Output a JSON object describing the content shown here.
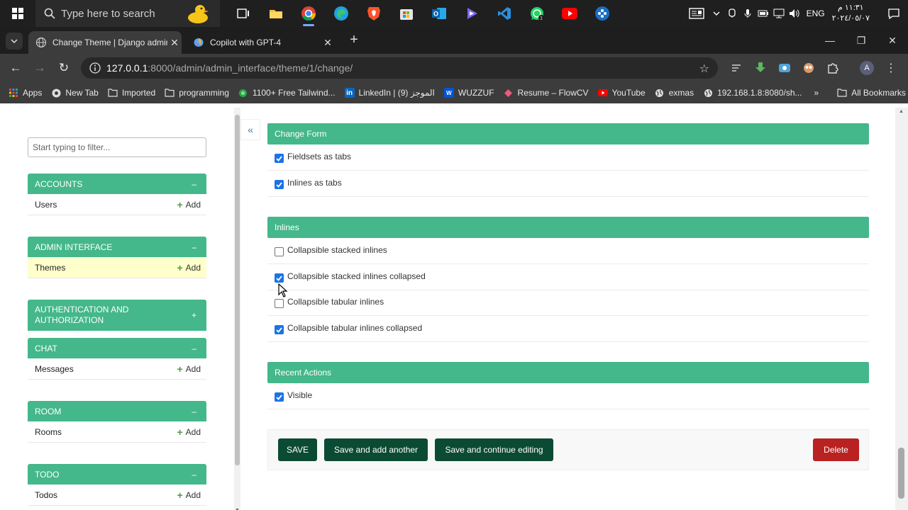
{
  "taskbar": {
    "search_placeholder": "Type here to search",
    "lang": "ENG",
    "time": "١١:٣١ م",
    "date": "٢٠٢٤/٠٥/٠٧"
  },
  "browser": {
    "tabs": [
      {
        "title": "Change Theme | Django admin"
      },
      {
        "title": "Copilot with GPT-4"
      }
    ],
    "url_host": "127.0.0.1",
    "url_path": ":8000/admin/admin_interface/theme/1/change/",
    "avatar_letter": "A",
    "bookmarks": [
      {
        "label": "Apps",
        "icon": "apps-grid-icon"
      },
      {
        "label": "New Tab",
        "icon": "newtab-icon"
      },
      {
        "label": "Imported",
        "icon": "folder-icon"
      },
      {
        "label": "programming",
        "icon": "folder-icon"
      },
      {
        "label": "1100+ Free Tailwind...",
        "icon": "tailwind-icon"
      },
      {
        "label": "LinkedIn | الموجز (9)",
        "icon": "linkedin-icon"
      },
      {
        "label": "WUZZUF",
        "icon": "wuzzuf-icon"
      },
      {
        "label": "Resume – FlowCV",
        "icon": "flowcv-icon"
      },
      {
        "label": "YouTube",
        "icon": "youtube-icon"
      },
      {
        "label": "exmas",
        "icon": "globe-icon"
      },
      {
        "label": "192.168.1.8:8080/sh...",
        "icon": "globe-icon"
      }
    ],
    "more_bookmarks": "»",
    "all_bookmarks": "All Bookmarks"
  },
  "sidebar": {
    "filter_placeholder": "Start typing to filter...",
    "collapse_label": "«",
    "add_label": "Add",
    "apps": [
      {
        "name": "ACCOUNTS",
        "toggle": "–",
        "models": [
          {
            "name": "Users",
            "current": false
          }
        ]
      },
      {
        "name": "ADMIN INTERFACE",
        "toggle": "–",
        "models": [
          {
            "name": "Themes",
            "current": true
          }
        ]
      },
      {
        "name": "AUTHENTICATION AND AUTHORIZATION",
        "toggle": "+",
        "models": []
      },
      {
        "name": "CHAT",
        "toggle": "–",
        "models": [
          {
            "name": "Messages",
            "current": false
          }
        ]
      },
      {
        "name": "ROOM",
        "toggle": "–",
        "models": [
          {
            "name": "Rooms",
            "current": false
          }
        ]
      },
      {
        "name": "TODO",
        "toggle": "–",
        "models": [
          {
            "name": "Todos",
            "current": false
          }
        ]
      }
    ]
  },
  "form": {
    "fieldsets": [
      {
        "title": "Change Form",
        "fields": [
          {
            "label": "Fieldsets as tabs",
            "checked": true
          },
          {
            "label": "Inlines as tabs",
            "checked": true
          }
        ]
      },
      {
        "title": "Inlines",
        "fields": [
          {
            "label": "Collapsible stacked inlines",
            "checked": false
          },
          {
            "label": "Collapsible stacked inlines collapsed",
            "checked": true
          },
          {
            "label": "Collapsible tabular inlines",
            "checked": false
          },
          {
            "label": "Collapsible tabular inlines collapsed",
            "checked": true
          }
        ]
      },
      {
        "title": "Recent Actions",
        "fields": [
          {
            "label": "Visible",
            "checked": true
          }
        ]
      }
    ],
    "buttons": {
      "save": "SAVE",
      "save_add": "Save and add another",
      "save_continue": "Save and continue editing",
      "delete": "Delete"
    }
  },
  "colors": {
    "accent": "#44b78b",
    "button_dark": "#0c4b33",
    "delete": "#ba2121",
    "current_row": "#ffffcc"
  }
}
